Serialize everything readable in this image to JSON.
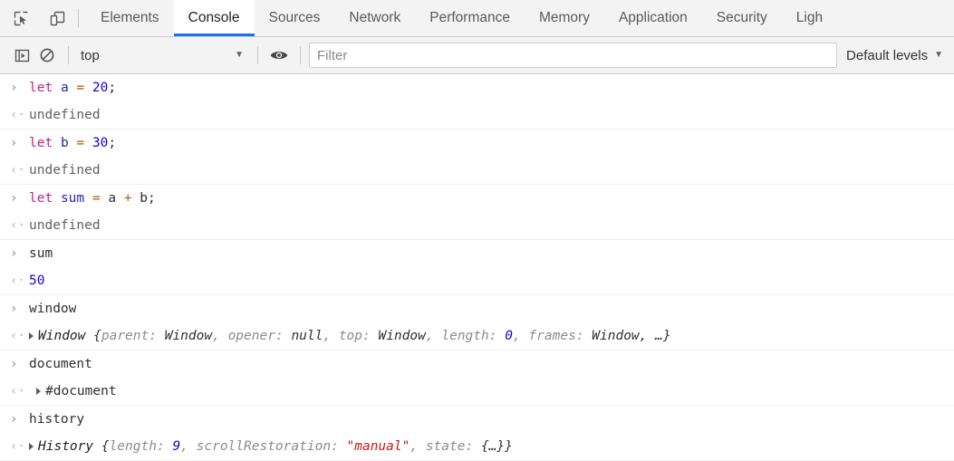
{
  "devtools": {
    "left_icons": [
      {
        "name": "inspect-element-icon",
        "label": "Inspect element"
      },
      {
        "name": "device-toolbar-icon",
        "label": "Toggle device toolbar"
      }
    ],
    "tabs": [
      {
        "label": "Elements",
        "active": false
      },
      {
        "label": "Console",
        "active": true
      },
      {
        "label": "Sources",
        "active": false
      },
      {
        "label": "Network",
        "active": false
      },
      {
        "label": "Performance",
        "active": false
      },
      {
        "label": "Memory",
        "active": false
      },
      {
        "label": "Application",
        "active": false
      },
      {
        "label": "Security",
        "active": false
      },
      {
        "label": "Ligh",
        "active": false
      }
    ],
    "active_tab_accent": "#1a73e8"
  },
  "toolbar": {
    "sidebar_toggle_icon": "console-sidebar-icon",
    "clear_console_icon": "clear-console-icon",
    "context_value": "top",
    "context_caret": "▼",
    "eye_icon": "eye-icon",
    "filter_placeholder": "Filter",
    "filter_value": "",
    "levels_label": "Default levels",
    "levels_caret": "▼"
  },
  "console": {
    "prompt_in": "›",
    "prompt_out": "‹·",
    "messages": [
      {
        "kind": "input",
        "tokens": [
          {
            "t": "let",
            "c": "kw"
          },
          {
            "t": " ",
            "c": "plain"
          },
          {
            "t": "a",
            "c": "var"
          },
          {
            "t": " ",
            "c": "plain"
          },
          {
            "t": "=",
            "c": "op"
          },
          {
            "t": " ",
            "c": "plain"
          },
          {
            "t": "20",
            "c": "num"
          },
          {
            "t": ";",
            "c": "punc"
          }
        ]
      },
      {
        "kind": "output",
        "tokens": [
          {
            "t": "undefined",
            "c": "undef"
          }
        ],
        "divider": true
      },
      {
        "kind": "input",
        "tokens": [
          {
            "t": "let",
            "c": "kw"
          },
          {
            "t": " ",
            "c": "plain"
          },
          {
            "t": "b",
            "c": "var"
          },
          {
            "t": " ",
            "c": "plain"
          },
          {
            "t": "=",
            "c": "op"
          },
          {
            "t": " ",
            "c": "plain"
          },
          {
            "t": "30",
            "c": "num"
          },
          {
            "t": ";",
            "c": "punc"
          }
        ]
      },
      {
        "kind": "output",
        "tokens": [
          {
            "t": "undefined",
            "c": "undef"
          }
        ],
        "divider": true
      },
      {
        "kind": "input",
        "tokens": [
          {
            "t": "let",
            "c": "kw"
          },
          {
            "t": " ",
            "c": "plain"
          },
          {
            "t": "sum",
            "c": "var"
          },
          {
            "t": " ",
            "c": "plain"
          },
          {
            "t": "=",
            "c": "op"
          },
          {
            "t": " ",
            "c": "plain"
          },
          {
            "t": "a",
            "c": "plain"
          },
          {
            "t": " ",
            "c": "plain"
          },
          {
            "t": "+",
            "c": "op"
          },
          {
            "t": " ",
            "c": "plain"
          },
          {
            "t": "b",
            "c": "plain"
          },
          {
            "t": ";",
            "c": "punc"
          }
        ]
      },
      {
        "kind": "output",
        "tokens": [
          {
            "t": "undefined",
            "c": "undef"
          }
        ],
        "divider": true
      },
      {
        "kind": "input",
        "tokens": [
          {
            "t": "sum",
            "c": "plain"
          }
        ]
      },
      {
        "kind": "output",
        "tokens": [
          {
            "t": "50",
            "c": "num"
          }
        ],
        "divider": true
      },
      {
        "kind": "input",
        "tokens": [
          {
            "t": "window",
            "c": "plain"
          }
        ]
      },
      {
        "kind": "output",
        "expandable": true,
        "tokens": [
          {
            "t": "Window",
            "c": "obj-name"
          },
          {
            "t": " {",
            "c": "obj-val"
          },
          {
            "t": "parent",
            "c": "obj-prop"
          },
          {
            "t": ": ",
            "c": "obj-prop"
          },
          {
            "t": "Window",
            "c": "obj-val"
          },
          {
            "t": ", ",
            "c": "obj-prop"
          },
          {
            "t": "opener",
            "c": "obj-prop"
          },
          {
            "t": ": ",
            "c": "obj-prop"
          },
          {
            "t": "null",
            "c": "obj-val"
          },
          {
            "t": ", ",
            "c": "obj-prop"
          },
          {
            "t": "top",
            "c": "obj-prop"
          },
          {
            "t": ": ",
            "c": "obj-prop"
          },
          {
            "t": "Window",
            "c": "obj-val"
          },
          {
            "t": ", ",
            "c": "obj-prop"
          },
          {
            "t": "length",
            "c": "obj-prop"
          },
          {
            "t": ": ",
            "c": "obj-prop"
          },
          {
            "t": "0",
            "c": "obj-num"
          },
          {
            "t": ", ",
            "c": "obj-prop"
          },
          {
            "t": "frames",
            "c": "obj-prop"
          },
          {
            "t": ": ",
            "c": "obj-prop"
          },
          {
            "t": "Window",
            "c": "obj-val"
          },
          {
            "t": ", …}",
            "c": "obj-val"
          }
        ],
        "divider": true
      },
      {
        "kind": "input",
        "tokens": [
          {
            "t": "document",
            "c": "plain"
          }
        ]
      },
      {
        "kind": "output",
        "expandable": true,
        "indent": true,
        "tokens": [
          {
            "t": "#document",
            "c": "node"
          }
        ],
        "divider": true
      },
      {
        "kind": "input",
        "tokens": [
          {
            "t": "history",
            "c": "plain"
          }
        ]
      },
      {
        "kind": "output",
        "expandable": true,
        "tokens": [
          {
            "t": "History",
            "c": "obj-name"
          },
          {
            "t": " {",
            "c": "obj-val"
          },
          {
            "t": "length",
            "c": "obj-prop"
          },
          {
            "t": ": ",
            "c": "obj-prop"
          },
          {
            "t": "9",
            "c": "obj-num"
          },
          {
            "t": ", ",
            "c": "obj-prop"
          },
          {
            "t": "scrollRestoration",
            "c": "obj-prop"
          },
          {
            "t": ": ",
            "c": "obj-prop"
          },
          {
            "t": "\"manual\"",
            "c": "obj-str"
          },
          {
            "t": ", ",
            "c": "obj-prop"
          },
          {
            "t": "state",
            "c": "obj-prop"
          },
          {
            "t": ": ",
            "c": "obj-prop"
          },
          {
            "t": "{…}}",
            "c": "obj-val"
          }
        ],
        "divider": true
      }
    ]
  }
}
